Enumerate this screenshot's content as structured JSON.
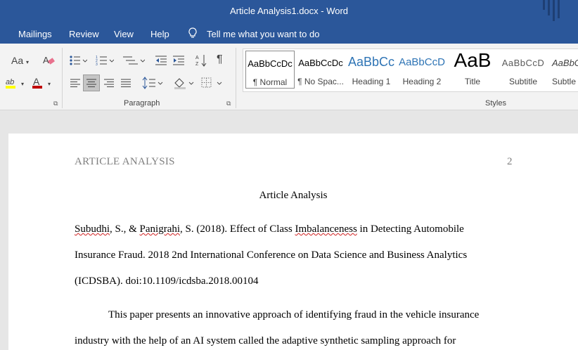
{
  "window": {
    "title": "Article Analysis1.docx  -  Word"
  },
  "menu": {
    "items": [
      "Mailings",
      "Review",
      "View",
      "Help"
    ],
    "tell_me": "Tell me what you want to do"
  },
  "ribbon": {
    "font_group": {
      "change_case": "Aa",
      "font_color_letter": "A"
    },
    "paragraph_group": {
      "label": "Paragraph"
    },
    "styles_group": {
      "label": "Styles",
      "items": [
        {
          "preview": "AaBbCcDc",
          "name": "¶ Normal"
        },
        {
          "preview": "AaBbCcDc",
          "name": "¶ No Spac..."
        },
        {
          "preview": "AaBbCc",
          "name": "Heading 1"
        },
        {
          "preview": "AaBbCcD",
          "name": "Heading 2"
        },
        {
          "preview": "AaB",
          "name": "Title"
        },
        {
          "preview": "AaBbCcD",
          "name": "Subtitle"
        },
        {
          "preview": "AaBbCcD",
          "name": "Subtle E"
        }
      ]
    }
  },
  "colors": {
    "title_bar": "#2b579a",
    "highlight": "#ffff00",
    "font_color": "#c00000",
    "heading_blue": "#2e74b5"
  },
  "document": {
    "header_left": "ARTICLE ANALYSIS",
    "page_number": "2",
    "title": "Article Analysis",
    "citation": {
      "author1": "Subudhi",
      "part1": ", S., & ",
      "author2": "Panigrahi",
      "part2": ", S. (2018). Effect of Class ",
      "word_imbal": "Imbalanceness",
      "part3": " in Detecting Automobile",
      "line2": "Insurance Fraud. 2018 2nd International Conference on Data Science and Business Analytics",
      "line3": "(ICDSBA). doi:10.1109/icdsba.2018.00104"
    },
    "body_line1": "This paper presents an innovative approach of identifying fraud in the vehicle insurance",
    "body_line2": "industry with the help of an AI system called the adaptive synthetic sampling approach for"
  }
}
